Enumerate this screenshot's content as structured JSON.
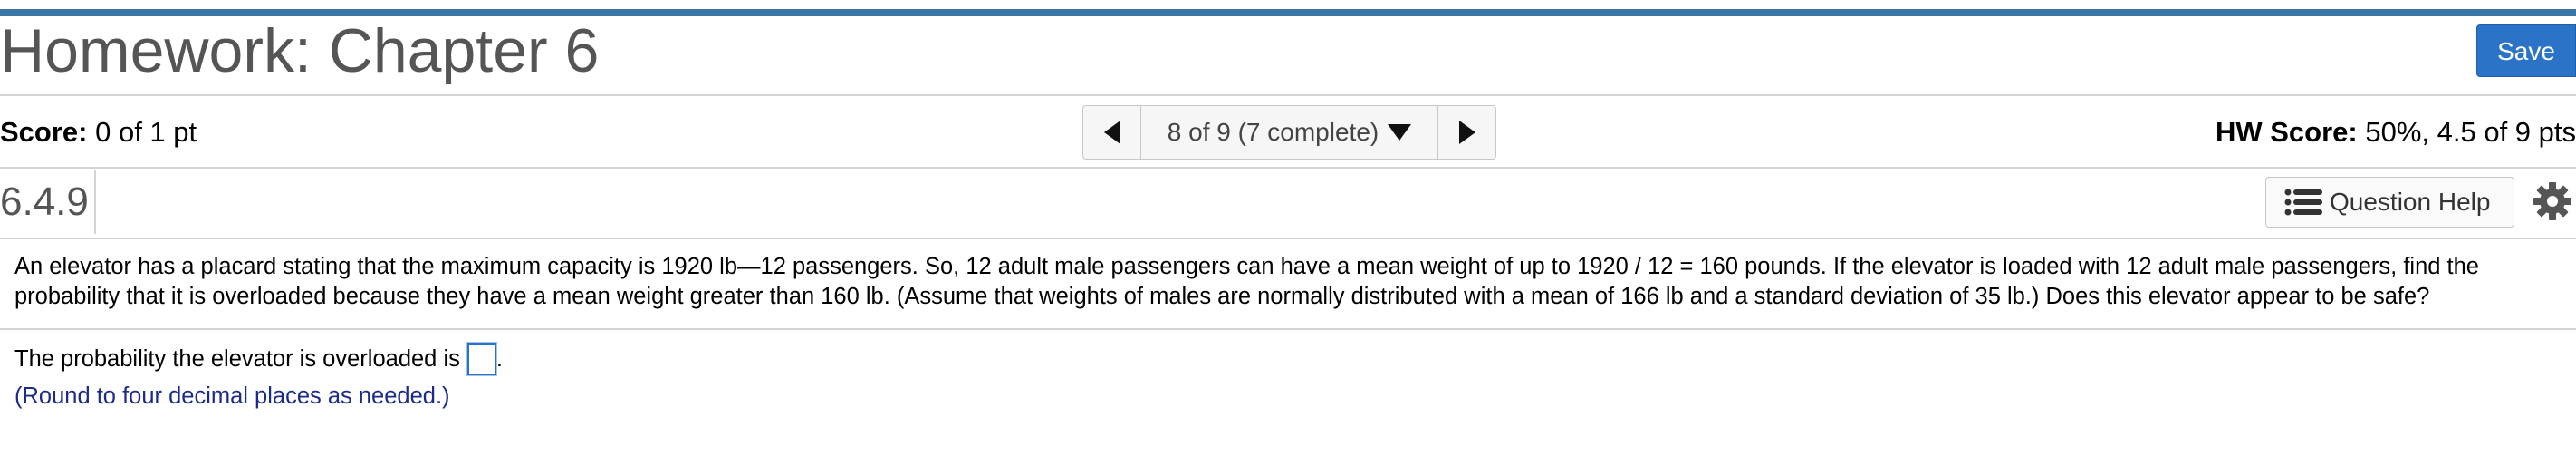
{
  "header": {
    "title": "Homework: Chapter 6",
    "save_label": "Save"
  },
  "score": {
    "label": "Score:",
    "value": "0 of 1 pt"
  },
  "navigator": {
    "label": "8 of 9 (7 complete)"
  },
  "hw_score": {
    "label": "HW Score:",
    "value": "50%, 4.5 of 9 pts"
  },
  "question": {
    "number": "6.4.9",
    "help_label": "Question Help",
    "problem_text": "An elevator has a placard stating that the maximum capacity is 1920 lb—12 passengers. So, 12 adult male passengers can have a mean weight of up to 1920 / 12 = 160 pounds. If the elevator is loaded with 12 adult male passengers, find the probability that it is overloaded because they have a mean weight greater than 160 lb. (Assume that weights of males are normally distributed with a mean of 166 lb and a standard deviation of 35 lb.) Does this elevator appear to be safe?",
    "answer_prompt": "The probability the elevator is overloaded is",
    "answer_value": "",
    "answer_suffix": ".",
    "hint": "(Round to four decimal places as needed.)"
  },
  "colors": {
    "accent_bar": "#3a76a5",
    "save_button": "#2b73c7",
    "hint_text": "#1c2b8a"
  },
  "icons": [
    "caret-left-icon",
    "caret-down-icon",
    "caret-right-icon",
    "list-icon",
    "gear-icon"
  ]
}
